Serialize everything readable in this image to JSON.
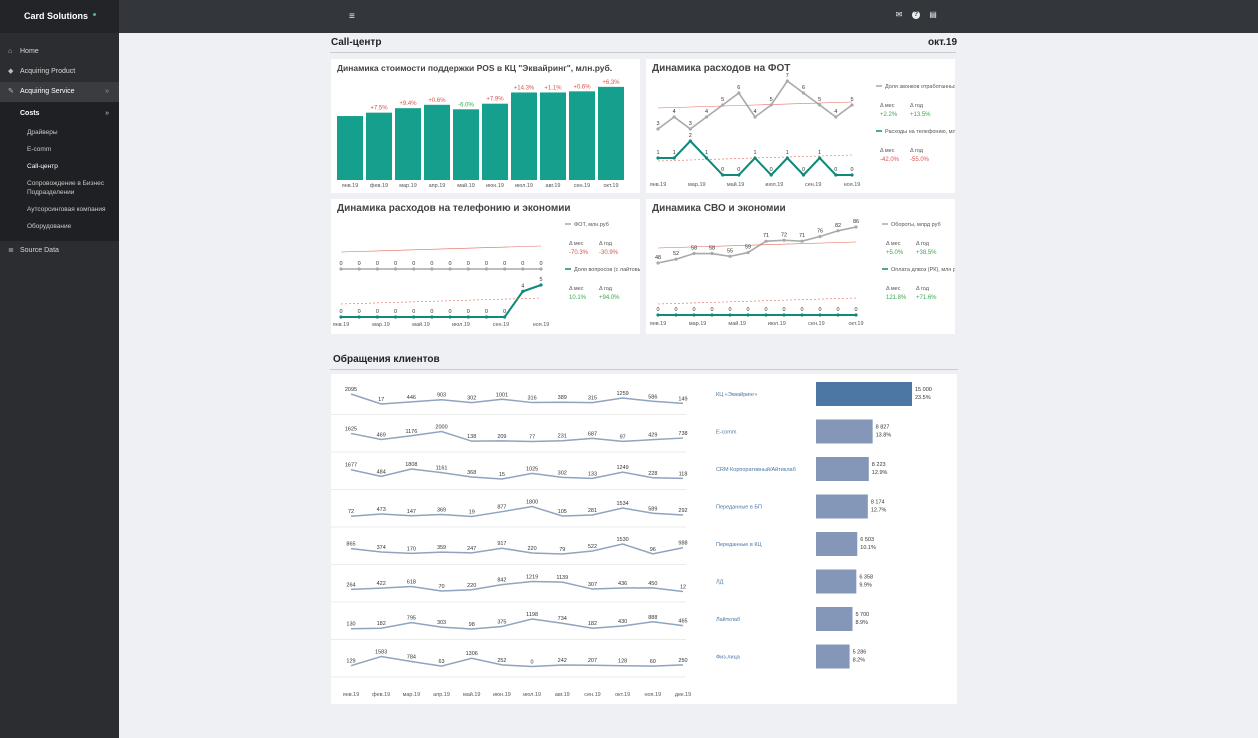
{
  "app": {
    "title": "Card Solutions"
  },
  "sidebar": {
    "items": [
      {
        "label": "Home"
      },
      {
        "label": "Acquiring Product"
      },
      {
        "label": "Acquiring Service"
      }
    ],
    "costs": {
      "label": "Costs"
    },
    "sub_items": [
      "Драйверы",
      "E-comm",
      "Call-центр",
      "Сопровождение в Бизнес Подразделении",
      "Аутсорсинговая компания",
      "Оборудование"
    ],
    "source": {
      "label": "Source Data"
    }
  },
  "page": {
    "title": "Call-центр",
    "period": "окт.19",
    "section2": "Обращения клиентов"
  },
  "cards": {
    "pos": {
      "title": "Динамика стоимости поддержки POS в КЦ \"Эквайринг\", млн.руб."
    },
    "fot": {
      "title": "Динамика расходов на ФОТ"
    },
    "tel": {
      "title": "Динамика расходов на телефонию и экономии"
    },
    "cvo": {
      "title": "Динамика СВО и экономии"
    }
  },
  "chart_data": [
    {
      "type": "bar",
      "title": "Динамика стоимости поддержки POS в КЦ \"Эквайринг\", млн.руб.",
      "categories": [
        "янв.19",
        "фев.19",
        "мар.19",
        "апр.19",
        "май.19",
        "июн.19",
        "июл.19",
        "авг.19",
        "сен.19",
        "окт.19"
      ],
      "values": [
        57,
        60,
        64,
        67,
        63,
        68,
        78,
        78,
        79,
        83
      ],
      "labels": [
        "",
        "+7.5%",
        "+9.4%",
        "+0.6%",
        "-6.0%",
        "+7.9%",
        "+14.3%",
        "+1.1%",
        "+0.6%",
        "+6.3%"
      ]
    },
    {
      "type": "line",
      "title": "Динамика расходов на ФОТ",
      "categories": [
        "янв.19",
        "мар.19",
        "май.19",
        "июл.19",
        "сен.19",
        "ноя.19"
      ],
      "series": [
        {
          "name": "Доля звонков, отработанных банком %",
          "values": [
            3,
            4,
            3,
            4,
            5,
            6,
            4,
            5,
            7,
            6,
            5,
            4,
            5
          ]
        },
        {
          "name": "Расходы на телефонию, млн.руб",
          "values": [
            1,
            1,
            2,
            1,
            0,
            0,
            1,
            0,
            1,
            0,
            1,
            0,
            0
          ]
        }
      ],
      "legend": [
        {
          "label": "Доля звонков отработанных банком %",
          "mes_label": "Δ мес",
          "mes": "+2.2%",
          "god_label": "Δ год",
          "god": "+13.5%"
        },
        {
          "label": "Расходы на телефонию, млн руб",
          "mes_label": "Δ мес",
          "mes": "-42.0%",
          "god_label": "Δ год",
          "god": "-55.0%"
        }
      ]
    },
    {
      "type": "line",
      "title": "Динамика расходов на телефонию и экономии",
      "categories": [
        "янв.19",
        "мар.19",
        "май.19",
        "июл.19",
        "сен.19",
        "ноя.19"
      ],
      "series": [
        {
          "name": "ФОТ, млн.руб",
          "values": [
            0,
            0,
            0,
            0,
            0,
            0,
            0,
            0,
            0,
            0,
            0,
            0
          ]
        },
        {
          "name": "Доля вопросов (с лайтовыми), отработанных банком %",
          "values": [
            0,
            0,
            0,
            0,
            0,
            0,
            0,
            0,
            0,
            0,
            4,
            5
          ]
        }
      ],
      "legend": [
        {
          "label": "ФОТ, млн.руб",
          "mes_label": "Δ мес",
          "mes": "-70.3%",
          "god_label": "Δ год",
          "god": "-30.9%"
        },
        {
          "label": "Доля вопросов (с лайтовыми), отработанных банком %",
          "mes_label": "Δ мес",
          "mes": "10.1%",
          "god_label": "Δ год",
          "god": "+94.0%"
        }
      ]
    },
    {
      "type": "line",
      "title": "Динамика СВО и экономии",
      "categories": [
        "янв.19",
        "мар.19",
        "май.19",
        "июл.19",
        "сен.19",
        "окт.19"
      ],
      "series": [
        {
          "name": "Обороты, млрд руб",
          "values": [
            48,
            52,
            58,
            58,
            55,
            59,
            71,
            72,
            71,
            76,
            82,
            86
          ]
        },
        {
          "name": "Оплата длвоз (РК), млн руб",
          "values": [
            0,
            0,
            0,
            0,
            0,
            0,
            0,
            0,
            0,
            0,
            0,
            0
          ]
        }
      ],
      "legend": [
        {
          "label": "Обороты, млрд руб",
          "mes_label": "Δ мес",
          "mes": "+5.0%",
          "god_label": "Δ год",
          "god": "+38.5%"
        },
        {
          "label": "Оплата длвоз (РК), млн руб",
          "mes_label": "Δ мес",
          "mes": "121.8%",
          "god_label": "Δ год",
          "god": "+71.6%"
        }
      ]
    },
    {
      "type": "line",
      "title": "Обращения клиентов",
      "categories": [
        "янв.19",
        "фев.19",
        "мар.19",
        "апр.19",
        "май.19",
        "июн.19",
        "июл.19",
        "авг.19",
        "сен.19",
        "окт.19",
        "ноя.19",
        "дек.19"
      ],
      "series": [
        {
          "name": "КЦ «Эквайринг»",
          "values": [
            2095,
            17,
            446,
            903,
            302,
            1001,
            316,
            389,
            315,
            1259,
            586,
            149
          ]
        },
        {
          "name": "E-comm",
          "values": [
            1625,
            469,
            1176,
            2000,
            138,
            209,
            77,
            231,
            687,
            97,
            429,
            738
          ]
        },
        {
          "name": "CRM Корпоративный/Айтиклаб",
          "values": [
            1677,
            484,
            1808,
            1161,
            368,
            15,
            1025,
            302,
            133,
            1249,
            228,
            118
          ]
        },
        {
          "name": "Переданные в БП",
          "values": [
            72,
            473,
            147,
            369,
            19,
            877,
            1800,
            105,
            281,
            1534,
            589,
            292
          ]
        },
        {
          "name": "Переданные в КЦ",
          "values": [
            865,
            374,
            170,
            359,
            247,
            917,
            220,
            79,
            522,
            1530,
            96,
            988
          ]
        },
        {
          "name": "ЛД",
          "values": [
            264,
            422,
            618,
            70,
            220,
            842,
            1219,
            1139,
            307,
            436,
            450,
            12
          ]
        },
        {
          "name": "Лайтклаб",
          "values": [
            130,
            182,
            795,
            303,
            98,
            375,
            1198,
            734,
            182,
            430,
            888,
            465
          ]
        },
        {
          "name": "Физ.лица",
          "values": [
            129,
            1583,
            784,
            63,
            1306,
            252,
            0,
            242,
            207,
            128,
            60,
            250
          ]
        }
      ],
      "bars": [
        {
          "name": "КЦ «Эквайринг»",
          "value": "15 000",
          "pct": "23.5%",
          "fraction": 1.0
        },
        {
          "name": "E-comm",
          "value": "8 827",
          "pct": "13.8%",
          "fraction": 0.59
        },
        {
          "name": "CRM Корпоративный/Айтиклаб",
          "value": "8 223",
          "pct": "12.9%",
          "fraction": 0.55
        },
        {
          "name": "Переданные в БП",
          "value": "8 174",
          "pct": "12.7%",
          "fraction": 0.54
        },
        {
          "name": "Переданные в КЦ",
          "value": "6 503",
          "pct": "10.1%",
          "fraction": 0.43
        },
        {
          "name": "ЛД",
          "value": "6 358",
          "pct": "9.9%",
          "fraction": 0.42
        },
        {
          "name": "Лайтклаб",
          "value": "5 700",
          "pct": "8.9%",
          "fraction": 0.38
        },
        {
          "name": "Физ.лица",
          "value": "5 286",
          "pct": "8.2%",
          "fraction": 0.35
        }
      ]
    }
  ],
  "colors": {
    "teal": "#14a08c",
    "gray": "#a9a9a9",
    "teal_dark": "#0f8a79",
    "row_line": "#8fa4bf",
    "bar_main": "#4c77a4",
    "bar": "#8497b9",
    "up": "#3aa84f",
    "down": "#d9534f"
  }
}
